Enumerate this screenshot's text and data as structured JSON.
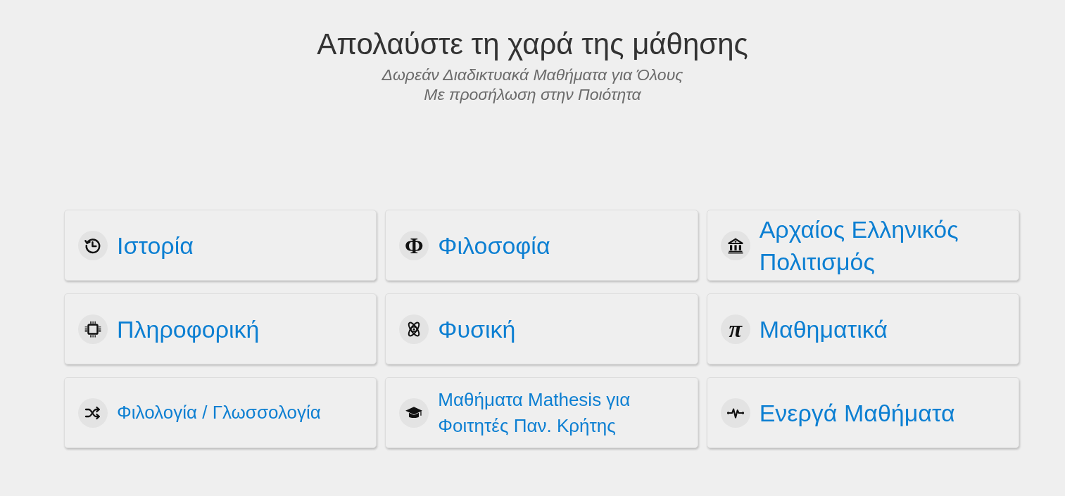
{
  "header": {
    "title": "Απολαύστε τη χαρά της μάθησης",
    "subtitle_lines": [
      "Δωρεάν Διαδικτυακά Μαθήματα για Όλους",
      "Με προσήλωση στην Ποιότητα"
    ]
  },
  "categories": [
    {
      "label": "Ιστορία",
      "kind": "history"
    },
    {
      "label": "Φιλοσοφία",
      "kind": "glyph",
      "icon_glyph": "Φ"
    },
    {
      "label": "Αρχαίος Ελληνικός Πολιτισμός",
      "kind": "temple"
    },
    {
      "label": "Πληροφορική",
      "kind": "chip"
    },
    {
      "label": "Φυσική",
      "kind": "atom"
    },
    {
      "label": "Μαθηματικά",
      "kind": "glyph-italic",
      "icon_glyph": "π"
    },
    {
      "label": "Φιλολογία / Γλωσσολογία",
      "kind": "shuffle"
    },
    {
      "label": "Μαθήματα Mathesis για Φοιτητές Παν. Κρήτης",
      "kind": "cap"
    },
    {
      "label": "Ενεργά Μαθήματα",
      "kind": "pulse"
    }
  ]
}
